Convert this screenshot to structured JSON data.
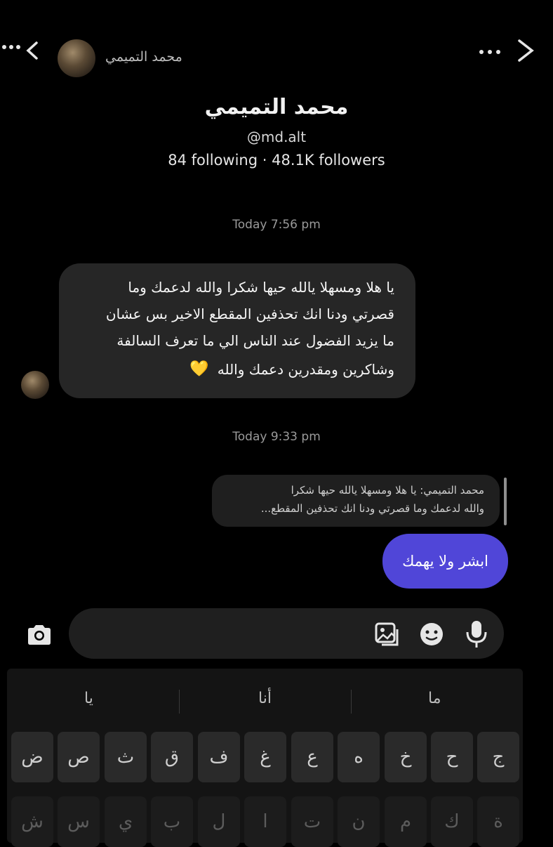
{
  "header": {
    "contact_name": "محمد التميمي"
  },
  "profile": {
    "name": "محمد التميمي",
    "handle": "@md.alt",
    "stats": "84 following · 48.1K followers"
  },
  "messages": {
    "time1": "Today 7:56 pm",
    "incoming_lines": [
      "يا هلا ومسهلا يالله حيها شكرا والله لدعمك وما",
      "قصرتي ودنا انك تحذفين المقطع الاخير بس عشان",
      "ما يزيد الفضول عند الناس الي ما تعرف السالفة",
      "وشاكرين ومقدرين دعمك والله"
    ],
    "heart_emoji": "💛",
    "time2": "Today 9:33 pm",
    "reply_quote_lines": [
      "محمد التميمي: يا هلا ومسهلا يالله حيها شكرا",
      "والله لدعمك وما قصرتي ودنا انك تحذفين المقطع..."
    ],
    "outgoing": "ابشر ولا يهمك"
  },
  "keyboard": {
    "suggestions": [
      "يا",
      "أنا",
      "ما"
    ],
    "row1": [
      "ض",
      "ص",
      "ث",
      "ق",
      "ف",
      "غ",
      "ع",
      "ه",
      "خ",
      "ح",
      "ج"
    ],
    "row2": [
      "ش",
      "س",
      "ي",
      "ب",
      "ل",
      "ا",
      "ت",
      "ن",
      "م",
      "ك",
      "ة"
    ]
  },
  "icons": {
    "back": "chevron-left-icon",
    "more": "more-dots-icon",
    "camera": "camera-icon",
    "gallery": "gallery-icon",
    "sticker": "sticker-icon",
    "mic": "microphone-icon"
  },
  "colors": {
    "background": "#000000",
    "incoming_bubble": "#262626",
    "outgoing_bubble": "#5046d8"
  }
}
